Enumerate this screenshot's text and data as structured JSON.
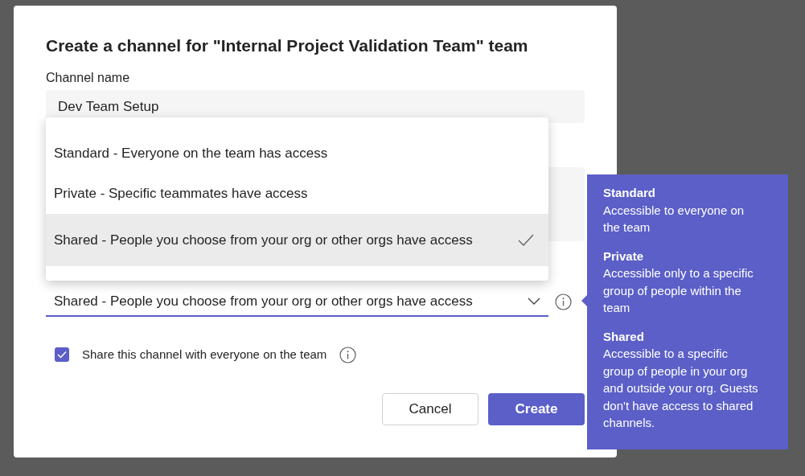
{
  "dialog": {
    "title": "Create a channel for \"Internal Project Validation Team\" team",
    "channel_name": {
      "label": "Channel name",
      "value": "Dev Team Setup"
    },
    "privacy": {
      "value": "Shared - People you choose from your org or other orgs have access",
      "expanded": true,
      "options": [
        {
          "label": "Standard - Everyone on the team has access",
          "selected": false
        },
        {
          "label": "Private - Specific teammates have access",
          "selected": false
        },
        {
          "label": "Shared - People you choose from your org or other orgs have access",
          "selected": true
        }
      ]
    },
    "share_checkbox": {
      "label": "Share this channel with everyone on the team",
      "checked": true
    },
    "tooltip": {
      "sections": [
        {
          "heading": "Standard",
          "text": "Accessible to everyone on the team"
        },
        {
          "heading": "Private",
          "text": "Accessible only to a specific group of people within the team"
        },
        {
          "heading": "Shared",
          "text": "Accessible to a specific group of people in your org and outside your org. Guests don't have access to shared channels."
        }
      ]
    },
    "buttons": [
      {
        "label": "Cancel",
        "kind": "secondary"
      },
      {
        "label": "Create",
        "kind": "primary"
      }
    ]
  }
}
